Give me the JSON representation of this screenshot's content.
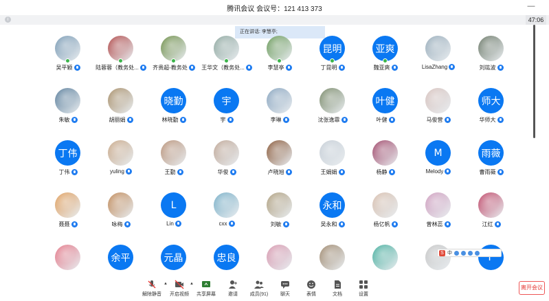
{
  "window": {
    "title": "腾讯会议 会议号：121 413 373",
    "min_glyph": "—"
  },
  "timer": "47:06",
  "speaking": "正在讲话: 李慧亭;",
  "participants": [
    {
      "name": "吴平颖",
      "avatar": "",
      "photo": "#7a9bb5",
      "badge": true
    },
    {
      "name": "陆蓉蓉（教务处...",
      "avatar": "",
      "photo": "#b04a4a",
      "badge": true
    },
    {
      "name": "齐贵超-教务处",
      "avatar": "",
      "photo": "#6f8f4a",
      "badge": true
    },
    {
      "name": "王华文（教务处...",
      "avatar": "",
      "photo": "#8fa8a0",
      "badge": true
    },
    {
      "name": "李慧亭",
      "avatar": "",
      "photo": "#6a9a5a",
      "badge": true
    },
    {
      "name": "丁昆明",
      "avatar": "昆明",
      "photo": "",
      "badge": true
    },
    {
      "name": "魏亚爽",
      "avatar": "亚爽",
      "photo": "",
      "badge": true
    },
    {
      "name": "LisaZhang",
      "avatar": "",
      "photo": "#9aaebc",
      "badge": false
    },
    {
      "name": "刘竑波",
      "avatar": "",
      "photo": "#6d7a6a",
      "badge": false
    },
    {
      "name": "朱敏",
      "avatar": "",
      "photo": "#5b7f9c",
      "badge": false
    },
    {
      "name": "胡丽娟",
      "avatar": "",
      "photo": "#a88f6a",
      "badge": false
    },
    {
      "name": "林晓勤",
      "avatar": "晓勤",
      "photo": "",
      "badge": false
    },
    {
      "name": "宇",
      "avatar": "宇",
      "photo": "",
      "badge": false
    },
    {
      "name": "李琳",
      "avatar": "",
      "photo": "#8aa6c0",
      "badge": false
    },
    {
      "name": "沈张逸霏",
      "avatar": "",
      "photo": "#7a8a6a",
      "badge": false
    },
    {
      "name": "叶健",
      "avatar": "叶健",
      "photo": "",
      "badge": false
    },
    {
      "name": "马俊营",
      "avatar": "",
      "photo": "#d8c4c0",
      "badge": false
    },
    {
      "name": "华师大",
      "avatar": "师大",
      "photo": "",
      "badge": false
    },
    {
      "name": "丁伟",
      "avatar": "丁伟",
      "photo": "",
      "badge": false
    },
    {
      "name": "yuling",
      "avatar": "",
      "photo": "#c9a98a",
      "badge": false
    },
    {
      "name": "王勤",
      "avatar": "",
      "photo": "#b9937a",
      "badge": false
    },
    {
      "name": "华俊",
      "avatar": "",
      "photo": "#c0a898",
      "badge": false
    },
    {
      "name": "卢晓旭",
      "avatar": "",
      "photo": "#8a5a3a",
      "badge": false
    },
    {
      "name": "王娟娟",
      "avatar": "",
      "photo": "#c8d0d8",
      "badge": false
    },
    {
      "name": "杨静",
      "avatar": "",
      "photo": "#a0486a",
      "badge": false
    },
    {
      "name": "Melody",
      "avatar": "M",
      "photo": "",
      "badge": false
    },
    {
      "name": "曹雨薇",
      "avatar": "雨薇",
      "photo": "",
      "badge": false
    },
    {
      "name": "聂聂",
      "avatar": "",
      "photo": "#e0a060",
      "badge": false
    },
    {
      "name": "咏梅",
      "avatar": "",
      "photo": "#c08a5a",
      "badge": false
    },
    {
      "name": "Lin",
      "avatar": "L",
      "photo": "",
      "badge": false
    },
    {
      "name": "cxx",
      "avatar": "",
      "photo": "#7ab0c8",
      "badge": false
    },
    {
      "name": "刘敏",
      "avatar": "",
      "photo": "#b0a080",
      "badge": false
    },
    {
      "name": "吴永和",
      "avatar": "永和",
      "photo": "",
      "badge": false
    },
    {
      "name": "杨亿帆",
      "avatar": "",
      "photo": "#d8c0b0",
      "badge": false
    },
    {
      "name": "曾林蕊",
      "avatar": "",
      "photo": "#d0a0c0",
      "badge": false
    },
    {
      "name": "江红",
      "avatar": "",
      "photo": "#c04a6a",
      "badge": false
    },
    {
      "name": "",
      "avatar": "",
      "photo": "#e47a8a",
      "badge": false
    },
    {
      "name": "",
      "avatar": "余平",
      "photo": "",
      "badge": false
    },
    {
      "name": "",
      "avatar": "元晶",
      "photo": "",
      "badge": false
    },
    {
      "name": "",
      "avatar": "忠良",
      "photo": "",
      "badge": false
    },
    {
      "name": "",
      "avatar": "",
      "photo": "#d89ab0",
      "badge": false
    },
    {
      "name": "",
      "avatar": "",
      "photo": "#a08a70",
      "badge": false
    },
    {
      "name": "",
      "avatar": "",
      "photo": "#4ab0a0",
      "badge": false
    },
    {
      "name": "",
      "avatar": "",
      "photo": "#c8c8c8",
      "badge": false
    },
    {
      "name": "",
      "avatar": "F",
      "photo": "",
      "badge": false
    }
  ],
  "ime": {
    "brand": "S",
    "mode": "中"
  },
  "toolbar": {
    "mute": "解除静音",
    "video": "开启视频",
    "share": "共享屏幕",
    "invite": "邀请",
    "members": "成员(91)",
    "chat": "聊天",
    "emoji": "表情",
    "docs": "文档",
    "settings": "设置",
    "leave": "离开会议"
  },
  "colors": {
    "accent": "#0a78f2",
    "leave": "#e53935",
    "active": "#3bb54a"
  }
}
